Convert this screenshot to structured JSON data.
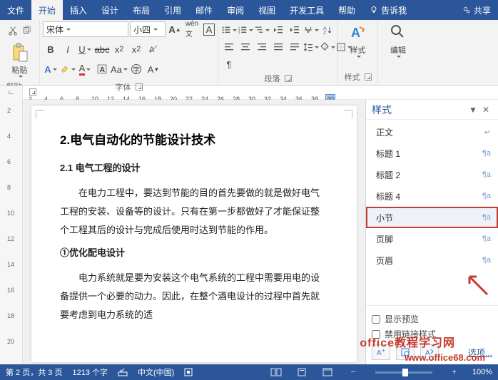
{
  "tabs": {
    "file": "文件",
    "home": "开始",
    "insert": "插入",
    "design": "设计",
    "layout": "布局",
    "references": "引用",
    "mailings": "邮件",
    "review": "审阅",
    "view": "视图",
    "developer": "开发工具",
    "help": "帮助",
    "tellme": "告诉我",
    "share": "共享"
  },
  "ribbon": {
    "clipboard": {
      "label": "剪贴板",
      "paste": "粘贴"
    },
    "font": {
      "label": "字体",
      "name": "宋体",
      "size": "小四",
      "grow": "A",
      "shrink": "A",
      "case": "Aa"
    },
    "paragraph": {
      "label": "段落"
    },
    "styles": {
      "label": "样式",
      "btn": "样式"
    },
    "editing": {
      "label": "编辑",
      "btn": "编辑"
    }
  },
  "ruler": {
    "marks": [
      2,
      4,
      6,
      8,
      10,
      12,
      14,
      16,
      18,
      20,
      22,
      24,
      26,
      28,
      30,
      32,
      34,
      36,
      38,
      40
    ],
    "highlight": 40
  },
  "vruler": {
    "marks": [
      2,
      4,
      6,
      8,
      10,
      12,
      14,
      16,
      18,
      20
    ]
  },
  "doc": {
    "h2": "2.电气自动化的节能设计技术",
    "h3a": "2.1 电气工程的设计",
    "p1": "在电力工程中，要达到节能的目的首先要做的就是做好电气工程的安装、设备等的设计。只有在第一步都做好了才能保证整个工程其后的设计与完成后使用时达到节能的作用。",
    "h3b": "①优化配电设计",
    "p2": "电力系统就是要为安装这个电气系统的工程中需要用电的设备提供一个必要的动力。因此，在整个酒电设计的过程中首先就要考虑到电力系统的适"
  },
  "pane": {
    "title": "样式",
    "items": [
      {
        "label": "正文",
        "mark": "↵"
      },
      {
        "label": "标题 1",
        "mark": "¶a"
      },
      {
        "label": "标题 2",
        "mark": "¶a"
      },
      {
        "label": "标题 4",
        "mark": "¶a"
      },
      {
        "label": "小节",
        "mark": "¶a"
      },
      {
        "label": "页脚",
        "mark": "¶a"
      },
      {
        "label": "页眉",
        "mark": "¶a"
      }
    ],
    "show_preview": "显示预览",
    "disable_linked": "禁用链接样式",
    "options": "选项..."
  },
  "status": {
    "page": "第 2 页，共 3 页",
    "words": "1213 个字",
    "lang": "中文(中国)",
    "zoom": "100%"
  },
  "watermark": {
    "line1": "office教程学习网",
    "line2": "www.office68.com"
  }
}
